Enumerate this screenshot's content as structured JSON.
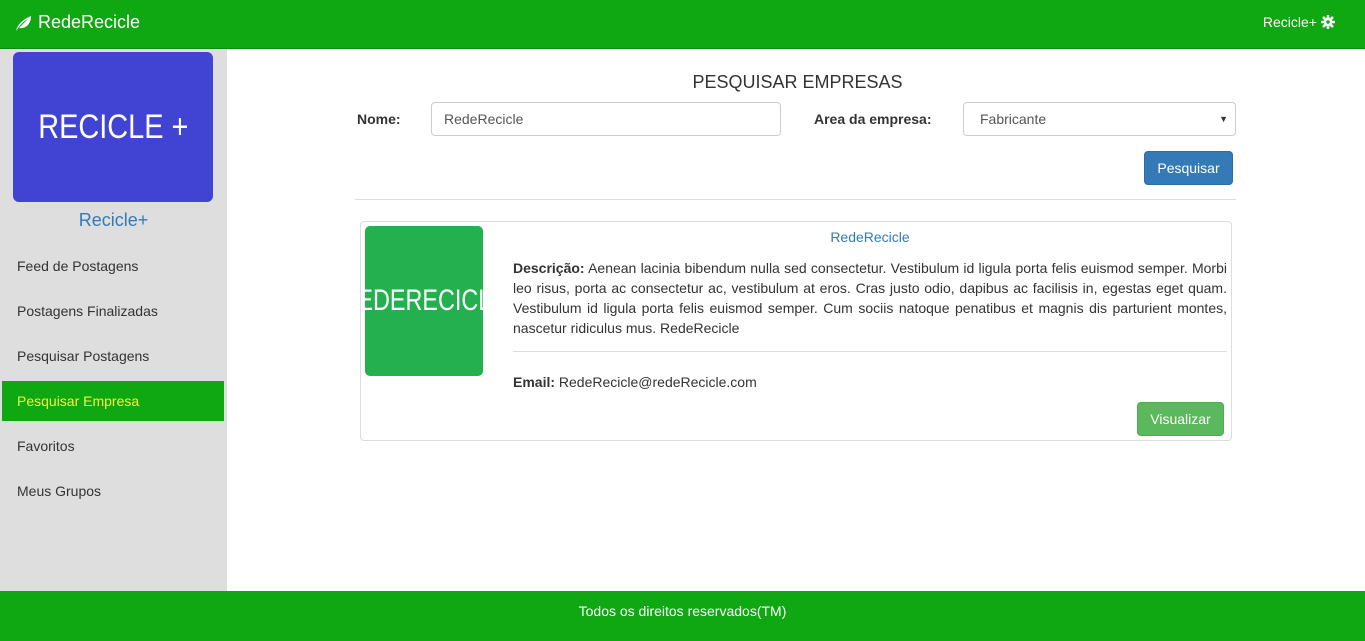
{
  "colors": {
    "brand_green": "#0fa712",
    "sidebar_bg": "#dedede",
    "logo_blue": "#4144d2",
    "card_logo_green": "#24b04e",
    "link_blue": "#337ab7",
    "active_text": "#f4f43a"
  },
  "navbar": {
    "brand_icon": "leaf-icon",
    "brand": "RedeRecicle",
    "user_label": "Recicle+",
    "user_icon": "gear-icon"
  },
  "sidebar": {
    "logo_text": "RECICLE +",
    "profile_name": "Recicle+",
    "active_index": 3,
    "items": [
      {
        "label": "Feed de Postagens"
      },
      {
        "label": "Postagens Finalizadas"
      },
      {
        "label": "Pesquisar Postagens"
      },
      {
        "label": "Pesquisar Empresa"
      },
      {
        "label": "Favoritos"
      },
      {
        "label": "Meus Grupos"
      }
    ]
  },
  "search": {
    "title": "PESQUISAR EMPRESAS",
    "name_label": "Nome:",
    "name_value": "RedeRecicle",
    "area_label": "Area da empresa:",
    "area_value": "Fabricante",
    "button": "Pesquisar"
  },
  "result": {
    "logo_text": "REDERECICLE",
    "title": "RedeRecicle",
    "desc_label": "Descrição:",
    "desc_text": "Aenean lacinia bibendum nulla sed consectetur. Vestibulum id ligula porta felis euismod semper. Morbi leo risus, porta ac consectetur ac, vestibulum at eros. Cras justo odio, dapibus ac facilisis in, egestas eget quam. Vestibulum id ligula porta felis euismod semper. Cum sociis natoque penatibus et magnis dis parturient montes, nascetur ridiculus mus. RedeRecicle",
    "email_label": "Email:",
    "email_value": "RedeRecicle@redeRecicle.com",
    "button": "Visualizar"
  },
  "footer": {
    "text": "Todos os direitos reservados(TM)"
  }
}
